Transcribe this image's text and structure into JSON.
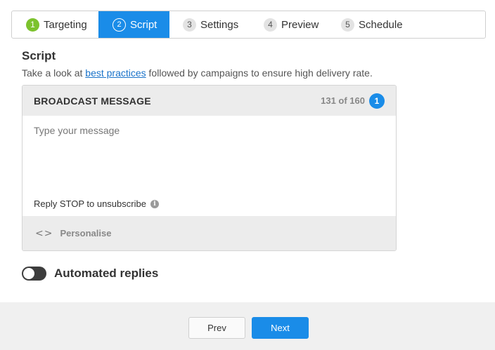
{
  "stepper": {
    "steps": [
      {
        "num": "1",
        "label": "Targeting",
        "state": "done"
      },
      {
        "num": "2",
        "label": "Script",
        "state": "active"
      },
      {
        "num": "3",
        "label": "Settings",
        "state": "pending"
      },
      {
        "num": "4",
        "label": "Preview",
        "state": "pending"
      },
      {
        "num": "5",
        "label": "Schedule",
        "state": "pending"
      }
    ]
  },
  "section": {
    "title": "Script",
    "desc_before": "Take a look at ",
    "desc_link": "best practices",
    "desc_after": " followed by campaigns to ensure high delivery rate."
  },
  "message_card": {
    "title": "BROADCAST MESSAGE",
    "counter": "131 of 160",
    "segment_count": "1",
    "input_value": "",
    "input_placeholder": "Type your message",
    "reply_stop": "Reply STOP to unsubscribe",
    "info_icon": "info-icon",
    "personalise_icon": "code-icon",
    "personalise_label": "Personalise"
  },
  "automated_replies": {
    "label": "Automated replies",
    "enabled": false
  },
  "footer": {
    "prev_label": "Prev",
    "next_label": "Next"
  },
  "colors": {
    "accent": "#1a8ce8",
    "done": "#7cc22d",
    "link": "#1a73c9"
  }
}
